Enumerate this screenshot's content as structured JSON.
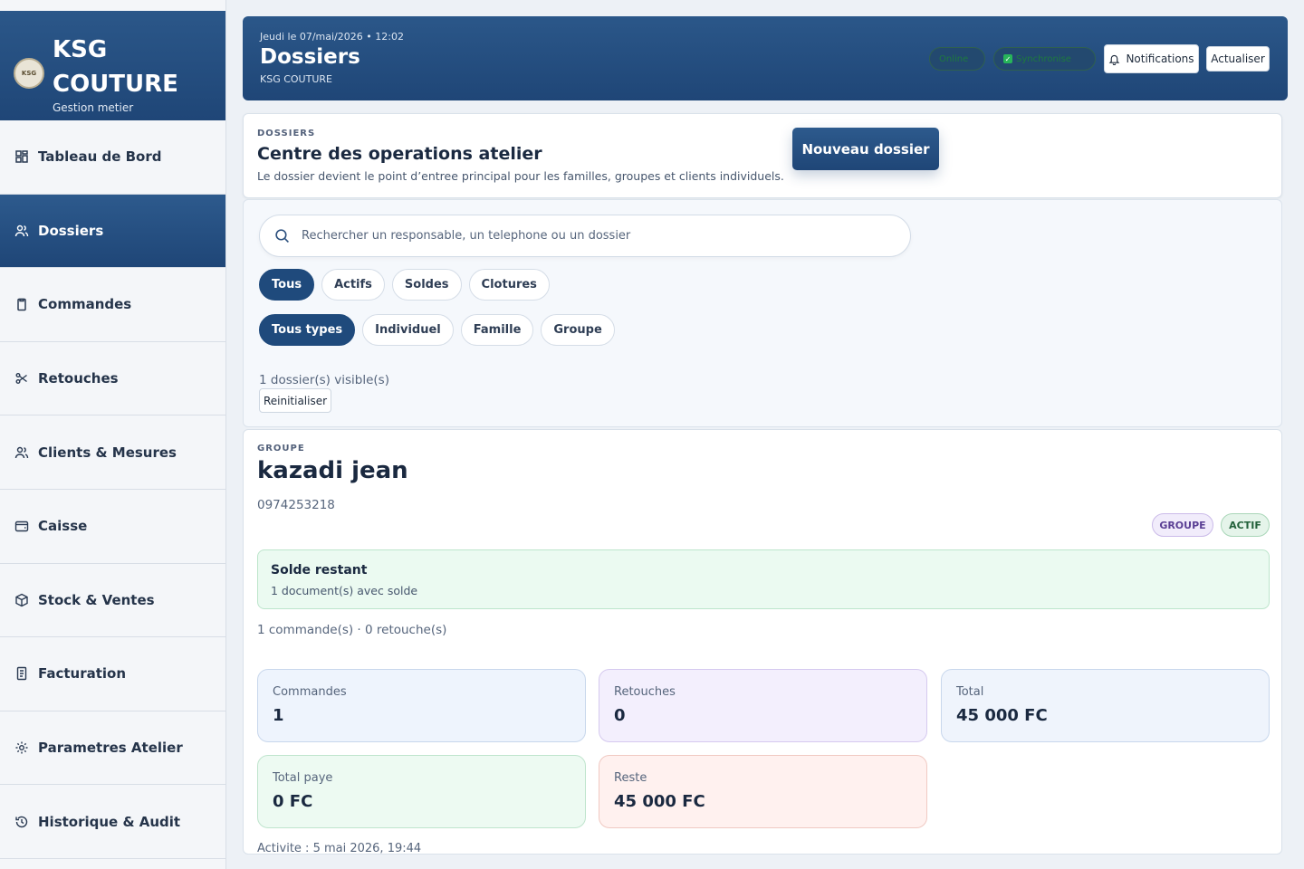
{
  "brand": {
    "title": "KSG COUTURE",
    "subtitle": "Gestion metier",
    "logo_text": "KSG"
  },
  "sidebar": {
    "items": [
      {
        "label": "Tableau de Bord",
        "icon": "dashboard-icon",
        "active": false
      },
      {
        "label": "Dossiers",
        "icon": "users-icon",
        "active": true
      },
      {
        "label": "Commandes",
        "icon": "clipboard-icon",
        "active": false
      },
      {
        "label": "Retouches",
        "icon": "scissors-icon",
        "active": false
      },
      {
        "label": "Clients & Mesures",
        "icon": "users-icon",
        "active": false
      },
      {
        "label": "Caisse",
        "icon": "wallet-icon",
        "active": false
      },
      {
        "label": "Stock & Ventes",
        "icon": "box-icon",
        "active": false
      },
      {
        "label": "Facturation",
        "icon": "invoice-icon",
        "active": false
      },
      {
        "label": "Parametres Atelier",
        "icon": "gear-icon",
        "active": false
      },
      {
        "label": "Historique & Audit",
        "icon": "history-icon",
        "active": false
      }
    ]
  },
  "header": {
    "date": "Jeudi le 07/mai/2026 • 12:02",
    "title": "Dossiers",
    "subtitle": "KSG COUTURE",
    "status_online": "Online",
    "status_sync": "Synchronise",
    "notifications_label": "Notifications",
    "refresh_label": "Actualiser"
  },
  "ops": {
    "kicker": "DOSSIERS",
    "title": "Centre des operations atelier",
    "description": "Le dossier devient le point d’entree principal pour les familles, groupes et clients individuels.",
    "new_button": "Nouveau dossier"
  },
  "filters": {
    "search_placeholder": "Rechercher un responsable, un telephone ou un dossier",
    "search_value": "",
    "status_chips": [
      "Tous",
      "Actifs",
      "Soldes",
      "Clotures"
    ],
    "status_active": "Tous",
    "type_chips": [
      "Tous types",
      "Individuel",
      "Famille",
      "Groupe"
    ],
    "type_active": "Tous types",
    "visible_count": "1 dossier(s) visible(s)",
    "reset_label": "Reinitialiser"
  },
  "dossier": {
    "kicker": "GROUPE",
    "name": "kazadi jean",
    "phone": "0974253218",
    "badge_type": "GROUPE",
    "badge_status": "ACTIF",
    "solde_title": "Solde restant",
    "solde_sub": "1 document(s) avec solde",
    "counts": "1 commande(s) · 0 retouche(s)",
    "stats": {
      "commandes": {
        "label": "Commandes",
        "value": "1"
      },
      "retouches": {
        "label": "Retouches",
        "value": "0"
      },
      "total": {
        "label": "Total",
        "value": "45 000 FC"
      },
      "total_paye": {
        "label": "Total paye",
        "value": "0 FC"
      },
      "reste": {
        "label": "Reste",
        "value": "45 000 FC"
      }
    },
    "activity": "Activite : 5 mai 2026, 19:44"
  },
  "colors": {
    "brand_blue": "#1f4677",
    "active_chip": "#1f4a7c",
    "success_bg": "#ebfaf1",
    "danger_bg": "#fff1ef"
  }
}
